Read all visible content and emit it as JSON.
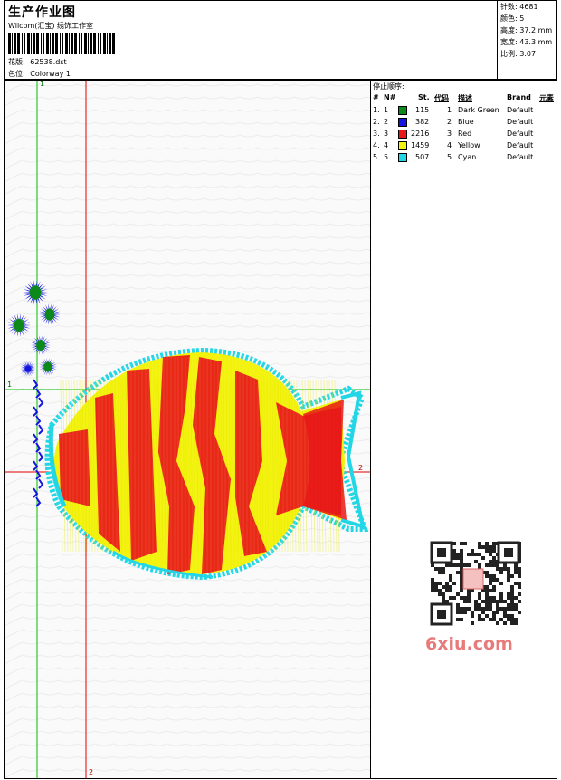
{
  "header": {
    "title": "生产作业图",
    "company": "Wilcom(汇宝) 绣饰工作室",
    "design_label": "花版:",
    "design_value": "62538.dst",
    "colorway_label": "色位:",
    "colorway_value": "Colorway 1"
  },
  "stats": {
    "stitches": "针数: 4681",
    "colors": "颜色: 5",
    "height": "高度: 37.2 mm",
    "width": "宽度: 43.3 mm",
    "ratio": "比例: 3.07"
  },
  "guides": {
    "v1_top": "1",
    "h1_left": "1",
    "h2_right": "2",
    "v2_bottom": "2"
  },
  "stop_table": {
    "title": "停止顺序:",
    "headers": [
      "#",
      "N#",
      "St.",
      "代码",
      "描述",
      "Brand",
      "元素"
    ],
    "rows": [
      {
        "num": "1.",
        "n": "1",
        "color": "#0b8a1a",
        "st": "115",
        "code": "1",
        "desc": "Dark Green",
        "brand": "Default"
      },
      {
        "num": "2.",
        "n": "2",
        "color": "#1414e0",
        "st": "382",
        "code": "2",
        "desc": "Blue",
        "brand": "Default"
      },
      {
        "num": "3.",
        "n": "3",
        "color": "#e81818",
        "st": "2216",
        "code": "3",
        "desc": "Red",
        "brand": "Default"
      },
      {
        "num": "4.",
        "n": "4",
        "color": "#f2f20a",
        "st": "1459",
        "code": "4",
        "desc": "Yellow",
        "brand": "Default"
      },
      {
        "num": "5.",
        "n": "5",
        "color": "#22d6e6",
        "st": "507",
        "code": "5",
        "desc": "Cyan",
        "brand": "Default"
      }
    ]
  },
  "watermark": {
    "text": "6xiu.com"
  },
  "colors": {
    "dark_green": "#0b8a1a",
    "blue": "#1414e0",
    "red": "#e81818",
    "yellow": "#f2f20a",
    "cyan": "#22d6e6",
    "guide_green": "#00c000",
    "guide_red": "#e00000"
  }
}
